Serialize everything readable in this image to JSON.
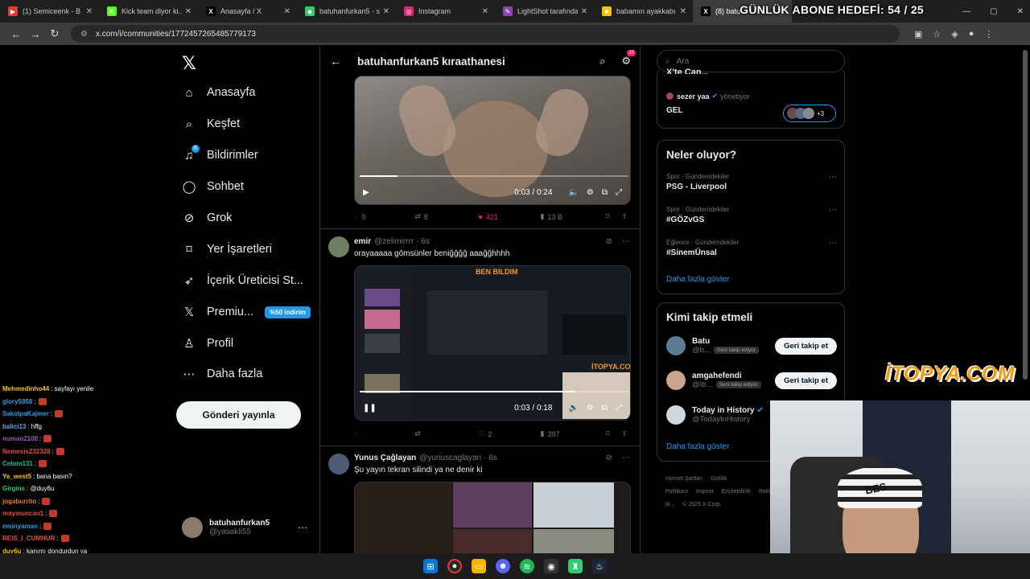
{
  "browser": {
    "tabs": [
      {
        "title": "(1) Semiceenk - B",
        "fav": "▶",
        "color": "#e53935"
      },
      {
        "title": "Kick team diyor ki...",
        "fav": "K",
        "color": "#53fc18"
      },
      {
        "title": "Anasayfa / X",
        "fav": "X",
        "color": "#000000"
      },
      {
        "title": "batuhanfurkan5 - say",
        "fav": "◆",
        "color": "#2ecc71"
      },
      {
        "title": "Instagram",
        "fav": "◎",
        "color": "#d62976"
      },
      {
        "title": "LightShot tarafından",
        "fav": "✎",
        "color": "#8e44ad"
      },
      {
        "title": "babamın ayakkabı ış",
        "fav": "■",
        "color": "#f1c40f"
      },
      {
        "title": "(8) batu",
        "fav": "X",
        "color": "#000000"
      }
    ],
    "url": "x.com/i/communities/1772457265485779173",
    "goal_text": "GÜNLÜK ABONE HEDEFİ: 54 / 25"
  },
  "nav": {
    "items": [
      {
        "label": "Anasayfa",
        "icon": "home-icon",
        "glyph": "⌂"
      },
      {
        "label": "Keşfet",
        "icon": "search-icon",
        "glyph": "⌕"
      },
      {
        "label": "Bildirimler",
        "icon": "bell-icon",
        "glyph": "♫"
      },
      {
        "label": "Sohbet",
        "icon": "chat-icon",
        "glyph": "◯"
      },
      {
        "label": "Grok",
        "icon": "grok-icon",
        "glyph": "⊘"
      },
      {
        "label": "Yer İşaretleri",
        "icon": "bookmark-icon",
        "glyph": "⌑"
      },
      {
        "label": "İçerik Üreticisi St...",
        "icon": "rocket-icon",
        "glyph": "➶"
      },
      {
        "label": "Premiu...",
        "icon": "x-premium-icon",
        "glyph": "𝕏"
      },
      {
        "label": "Profil",
        "icon": "profile-icon",
        "glyph": "♙"
      },
      {
        "label": "Daha fazla",
        "icon": "more-icon",
        "glyph": "⋯"
      }
    ],
    "notif_badge": "6",
    "premium_badge": "%50 indirim",
    "post_button": "Gönderi yayınla",
    "me": {
      "name": "batuhanfurkan5",
      "handle": "@yasakli55"
    }
  },
  "community": {
    "title": "batuhanfurkan5 kıraathanesi",
    "header_badge": "10",
    "tweets": [
      {
        "video_time": "0:03 / 0:24",
        "video_progress": 0.14,
        "replies": "9",
        "reposts": "8",
        "likes": "421",
        "views": "13 B"
      },
      {
        "name": "emir",
        "handle": "@zelimirrrr",
        "age": "· 6s",
        "text": "orayaaaaa gömsünler beniğğğğ aaağğhhhh",
        "video_time": "0:03 / 0:18",
        "video_progress": 0.8,
        "replies": "",
        "reposts": "",
        "likes": "2",
        "views": "397",
        "inner_title": "BEN BILDIM",
        "inner_brand": "İTOPYA.COM"
      },
      {
        "name": "Yunus Çağlayan",
        "handle": "@yunuscaglayan",
        "age": "· 6s",
        "text": "Şu yayın tekran silindi ya ne denir ki"
      }
    ]
  },
  "right": {
    "search_placeholder": "Ara",
    "partial_heading": "X'te Can...",
    "community_card": {
      "user": "sezer yaa",
      "role": "yönetiyor",
      "text": "GEL",
      "members_more": "+3"
    },
    "trending": {
      "title": "Neler oluyor?",
      "items": [
        {
          "cat": "Spor · Gündemdekiler",
          "topic": "PSG - Liverpool"
        },
        {
          "cat": "Spor · Gündemdekiler",
          "topic": "#GÖZvGS"
        },
        {
          "cat": "Eğlence · Gündemdekiler",
          "topic": "#SinemÜnsal"
        }
      ],
      "more": "Daha fazla göster"
    },
    "who_to_follow": {
      "title": "Kimi takip etmeli",
      "items": [
        {
          "name": "Batu",
          "handle": "@b...",
          "tag": "Seni takip ediyor",
          "button": "Geri takip et",
          "color": "#5d7a92"
        },
        {
          "name": "amgahefendi",
          "handle": "@Ib...",
          "tag": "Seni takip ediyor",
          "button": "Geri takip et",
          "color": "#c8a58a"
        },
        {
          "name": "Today in History",
          "handle": "@TodayInHistory",
          "tag": "",
          "button": "",
          "color": "#cfd8e0"
        }
      ],
      "more": "Daha fazla göster"
    },
    "footer": [
      "Hizmet Şartları",
      "Gizlilik Politikası",
      "Imprint",
      "Erişilebilirlik",
      "Reklam bi...",
      "© 2025 X Corp."
    ]
  },
  "chat": [
    {
      "user": "Mehmedinho44",
      "msg": ": sayfayı yenile",
      "color": "#f1c40f",
      "emote": false
    },
    {
      "user": "glory5858",
      "msg": ":",
      "color": "#3498db",
      "emote": true
    },
    {
      "user": "SakolpaKajmer",
      "msg": ":",
      "color": "#3498db",
      "emote": true
    },
    {
      "user": "balici13",
      "msg": ": hffg",
      "color": "#5dade2",
      "emote": false
    },
    {
      "user": "numan2108",
      "msg": ":",
      "color": "#9b59b6",
      "emote": true
    },
    {
      "user": "Nemesis232328",
      "msg": ":",
      "color": "#e74c3c",
      "emote": true
    },
    {
      "user": "Celom131",
      "msg": ":",
      "color": "#1abc9c",
      "emote": true
    },
    {
      "user": "Ye_west5",
      "msg": ": bana basın?",
      "color": "#f1c40f",
      "emote": false
    },
    {
      "user": "Girgins",
      "msg": ": @duy6u",
      "color": "#2ecc71",
      "emote": false
    },
    {
      "user": "jogaburrito",
      "msg": ":",
      "color": "#e67e22",
      "emote": true
    },
    {
      "user": "maymuncan1",
      "msg": ":",
      "color": "#e74c3c",
      "emote": true
    },
    {
      "user": "eminyaman",
      "msg": ":",
      "color": "#3498db",
      "emote": true
    },
    {
      "user": "REIS_I_CUMHUR",
      "msg": ":",
      "color": "#e74c3c",
      "emote": true
    },
    {
      "user": "duy6u",
      "msg": ": kanımı dondurdun ya",
      "color": "#f1c40f",
      "emote": false
    }
  ],
  "overlay": {
    "brand": "İTOPYA.COM",
    "beanie": "BES"
  }
}
